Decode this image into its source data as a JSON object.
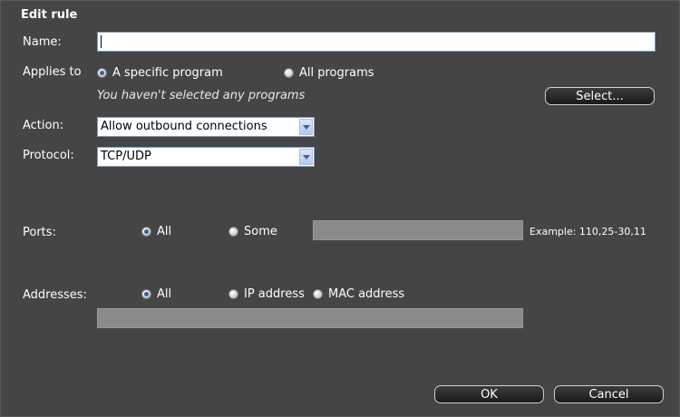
{
  "dialog": {
    "title": "Edit rule"
  },
  "name": {
    "label": "Name:",
    "value": ""
  },
  "applies": {
    "label": "Applies to",
    "options": [
      "A specific program",
      "All programs"
    ],
    "selected": "A specific program",
    "note": "You haven't selected any programs",
    "select_button": "Select..."
  },
  "action": {
    "label": "Action:",
    "value": "Allow outbound connections"
  },
  "protocol": {
    "label": "Protocol:",
    "value": "TCP/UDP"
  },
  "ports": {
    "label": "Ports:",
    "options": [
      "All",
      "Some"
    ],
    "selected": "All",
    "value": "",
    "example": "Example: 110,25-30,11"
  },
  "addresses": {
    "label": "Addresses:",
    "options": [
      "All",
      "IP address",
      "MAC address"
    ],
    "selected": "All",
    "value": ""
  },
  "footer": {
    "ok": "OK",
    "cancel": "Cancel"
  }
}
